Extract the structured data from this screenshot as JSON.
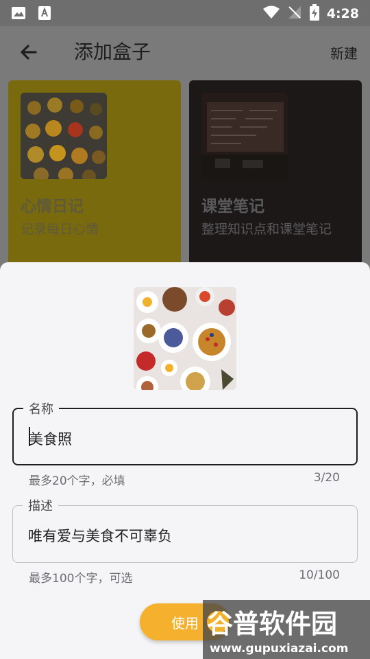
{
  "status_bar": {
    "time": "4:28"
  },
  "header": {
    "title": "添加盒子",
    "new_label": "新建"
  },
  "boxes": [
    {
      "title": "心情日记",
      "description": "记录每日心情"
    },
    {
      "title": "课堂笔记",
      "description": "整理知识点和课堂笔记"
    }
  ],
  "form": {
    "name": {
      "label": "名称",
      "value": "美食照",
      "helper": "最多20个字，必填",
      "counter": "3/20"
    },
    "description": {
      "label": "描述",
      "value": "唯有爱与美食不可辜负",
      "helper": "最多100个字，可选",
      "counter": "10/100"
    },
    "submit_label": "使用"
  },
  "watermark": {
    "text": "谷普软件园",
    "url": "www.gupuxiazai.com"
  },
  "colors": {
    "accent": "#f5b12d",
    "left_card": "#7a6a0e",
    "right_card": "#1c1818"
  }
}
